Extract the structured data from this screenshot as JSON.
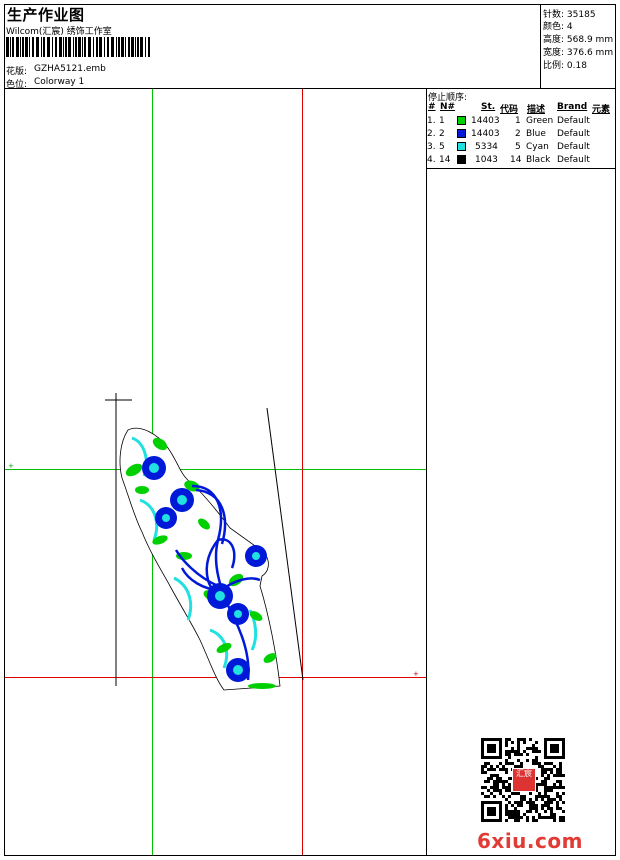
{
  "header": {
    "title": "生产作业图",
    "company": "Wilcom(汇宸) 绣饰工作室",
    "design_label": "花版:",
    "design_file": "GZHA5121.emb",
    "colorway_label": "色位:",
    "colorway": "Colorway 1"
  },
  "meta": [
    {
      "label": "针数:",
      "value": "35185"
    },
    {
      "label": "颜色:",
      "value": "4"
    },
    {
      "label": "高度:",
      "value": "568.9 mm"
    },
    {
      "label": "宽度:",
      "value": "376.6 mm"
    },
    {
      "label": "比例:",
      "value": "0.18"
    }
  ],
  "stop_sequence": {
    "title": "停止顺序:",
    "headers": {
      "hash": "#",
      "no": "N#",
      "st": "St.",
      "code": "代码",
      "desc": "描述",
      "brand": "Brand",
      "element": "元素"
    },
    "rows": [
      {
        "idx": "1.",
        "no": "1",
        "color": "#00d000",
        "st": "14403",
        "code": "1",
        "desc": "Green",
        "brand": "Default"
      },
      {
        "idx": "2.",
        "no": "2",
        "color": "#0018d8",
        "st": "14403",
        "code": "2",
        "desc": "Blue",
        "brand": "Default"
      },
      {
        "idx": "3.",
        "no": "5",
        "color": "#20e0e0",
        "st": "5334",
        "code": "5",
        "desc": "Cyan",
        "brand": "Default"
      },
      {
        "idx": "4.",
        "no": "14",
        "color": "#000000",
        "st": "1043",
        "code": "14",
        "desc": "Black",
        "brand": "Default"
      }
    ]
  },
  "colors": {
    "guide_green": "#00c000",
    "guide_red": "#e00000",
    "thread_green": "#00d000",
    "thread_blue": "#0018d8",
    "thread_cyan": "#20e0e0"
  },
  "watermark": "6xiu.com",
  "seal_text": "汇宸"
}
